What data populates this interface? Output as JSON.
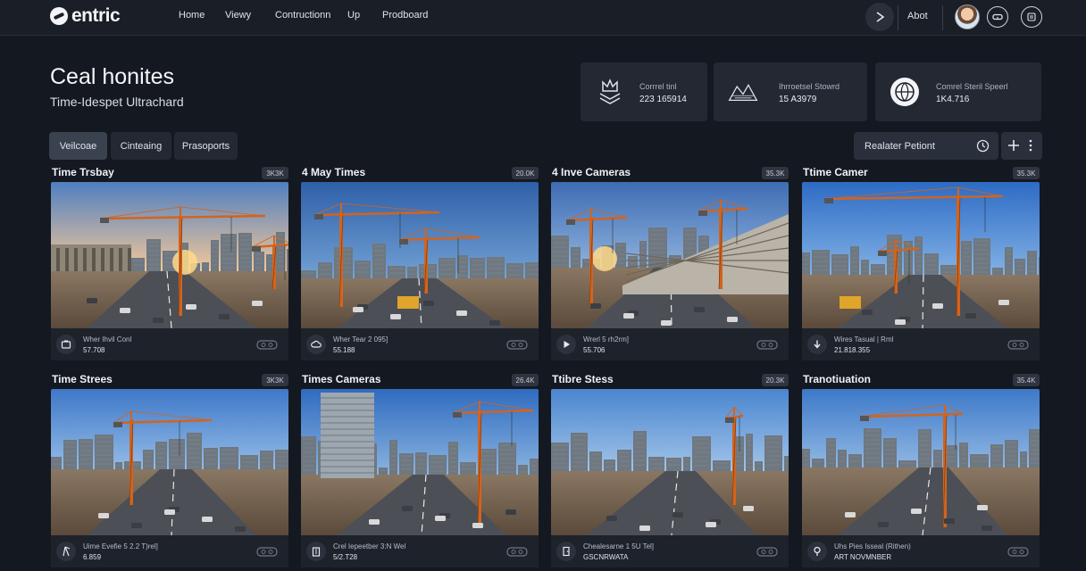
{
  "app": {
    "logo_text": "entric"
  },
  "nav": {
    "items": [
      "Home",
      "Viewy",
      "Contructionn",
      "Up",
      "Prodboard"
    ],
    "about": "Abot"
  },
  "hero": {
    "title": "Ceal honites",
    "subtitle": "Time-Idespet Ultrachard"
  },
  "stats": [
    {
      "label": "Corrrel tinl",
      "value": "223 165914",
      "icon": "crown-tray-icon"
    },
    {
      "label": "Ihrroetsel Stowrd",
      "value": "15 A3979",
      "icon": "mountain-map-icon"
    },
    {
      "label": "Comrel Steril Speerl",
      "value": "1K4.716",
      "icon": "globe-badge-icon"
    }
  ],
  "tabs": [
    {
      "label": "Veilcoae",
      "active": true
    },
    {
      "label": "Cinteaing",
      "active": false
    },
    {
      "label": "Prasoports",
      "active": false
    }
  ],
  "toolbar": {
    "report_label": "Realater Petiont"
  },
  "cameras": [
    {
      "title": "Time Trsbay",
      "badge": "3K3K",
      "line1": "Wher Ihvil Conl",
      "line2": "57.708",
      "foot_icon": "camera-icon",
      "scene": 0
    },
    {
      "title": "4 May Times",
      "badge": "20.0K",
      "line1": "Wher Tear 2 095]",
      "line2": "55.188",
      "foot_icon": "cloud-icon",
      "scene": 1
    },
    {
      "title": "4 Inve Cameras",
      "badge": "35.3K",
      "line1": "Wrerl 5 rh2rm]",
      "line2": "55.706",
      "foot_icon": "play-icon",
      "scene": 2
    },
    {
      "title": "Ttime Camer",
      "badge": "35.3K",
      "line1": "Wires Tasual | Rml",
      "line2": "21.818.355",
      "foot_icon": "download-icon",
      "scene": 3
    },
    {
      "title": "Time Strees",
      "badge": "3K3K",
      "line1": "Uime Evefie 5 2.2 T)rel]",
      "line2": "6.859",
      "foot_icon": "crane-icon",
      "scene": 4
    },
    {
      "title": "Times Cameras",
      "badge": "26.4K",
      "line1": "Crel Iepeetber 3:N Wel",
      "line2": "5/2.T28",
      "foot_icon": "building-icon",
      "scene": 5
    },
    {
      "title": "Ttibre Stess",
      "badge": "20.3K",
      "line1": "Chealesarne 1 5U Tel]",
      "line2": "GSCNRWATA",
      "foot_icon": "door-icon",
      "scene": 6
    },
    {
      "title": "Tranotiuation",
      "badge": "35.4K",
      "line1": "Uhs Pies Isseal (Rithen)",
      "line2": "ART NOVMNBER",
      "foot_icon": "pin-icon",
      "scene": 7
    }
  ],
  "colors": {
    "background": "#141820",
    "card": "#232833",
    "accent_crane": "#d2641e"
  }
}
